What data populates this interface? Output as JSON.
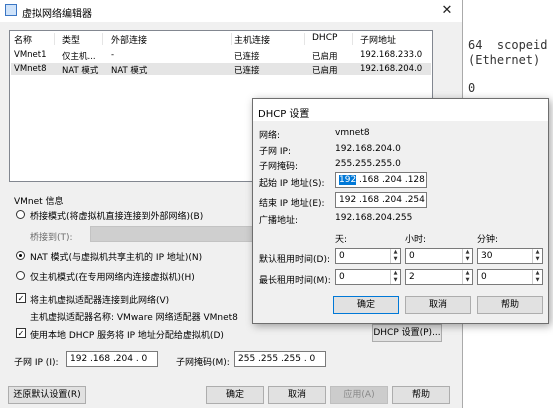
{
  "terminal": {
    "line1": "64  scopeid",
    "line2": "(Ethernet)",
    "line3": "0"
  },
  "main": {
    "title": "虚拟网络编辑器",
    "columns": [
      "名称",
      "类型",
      "外部连接",
      "主机连接",
      "DHCP",
      "子网地址"
    ],
    "rows": [
      {
        "name": "VMnet1",
        "type": "仅主机...",
        "external": "-",
        "host": "已连接",
        "dhcp": "已启用",
        "subnet": "192.168.233.0"
      },
      {
        "name": "VMnet8",
        "type": "NAT 模式",
        "external": "NAT 模式",
        "host": "已连接",
        "dhcp": "已启用",
        "subnet": "192.168.204.0"
      }
    ],
    "vmnet_info_label": "VMnet 信息",
    "bridge_radio": "桥接模式(将虚拟机直接连接到外部网络)(B)",
    "bridge_to_label": "桥接到(T):",
    "nat_radio": "NAT 模式(与虚拟机共享主机的 IP 地址)(N)",
    "hostonly_radio": "仅主机模式(在专用网络内连接虚拟机)(H)",
    "connect_adapter_check": "将主机虚拟适配器连接到此网络(V)",
    "adapter_name_text": "主机虚拟适配器名称: VMware 网络适配器 VMnet8",
    "use_dhcp_check": "使用本地 DHCP 服务将 IP 地址分配给虚拟机(D)",
    "dhcp_settings_button": "DHCP 设置(P)...",
    "subnet_ip_label": "子网 IP (I):",
    "subnet_ip_value": "192 .168 .204 . 0",
    "subnet_mask_label": "子网掩码(M):",
    "subnet_mask_value": "255 .255 .255 . 0",
    "restore_button": "还原默认设置(R)",
    "ok_button": "确定",
    "cancel_button": "取消",
    "apply_button": "应用(A)",
    "help_button": "帮助"
  },
  "dhcp": {
    "title": "DHCP 设置",
    "network_label": "网络:",
    "network_value": "vmnet8",
    "subnet_ip_label": "子网 IP:",
    "subnet_ip_value": "192.168.204.0",
    "subnet_mask_label": "子网掩码:",
    "subnet_mask_value": "255.255.255.0",
    "start_ip_label": "起始 IP 地址(S):",
    "start_ip_first": "192",
    "start_ip_rest": " .168 .204 .128",
    "end_ip_label": "结束 IP 地址(E):",
    "end_ip_value": "192 .168 .204 .254",
    "broadcast_label": "广播地址:",
    "broadcast_value": "192.168.204.255",
    "days_label": "天:",
    "hours_label": "小时:",
    "minutes_label": "分钟:",
    "default_lease_label": "默认租用时间(D):",
    "default_lease": {
      "days": "0",
      "hours": "0",
      "minutes": "30"
    },
    "max_lease_label": "最长租用时间(M):",
    "max_lease": {
      "days": "0",
      "hours": "2",
      "minutes": "0"
    },
    "ok_button": "确定",
    "cancel_button": "取消",
    "help_button": "帮助"
  },
  "colors": {
    "accent": "#0078d7",
    "selection": "#e5e5e5"
  }
}
